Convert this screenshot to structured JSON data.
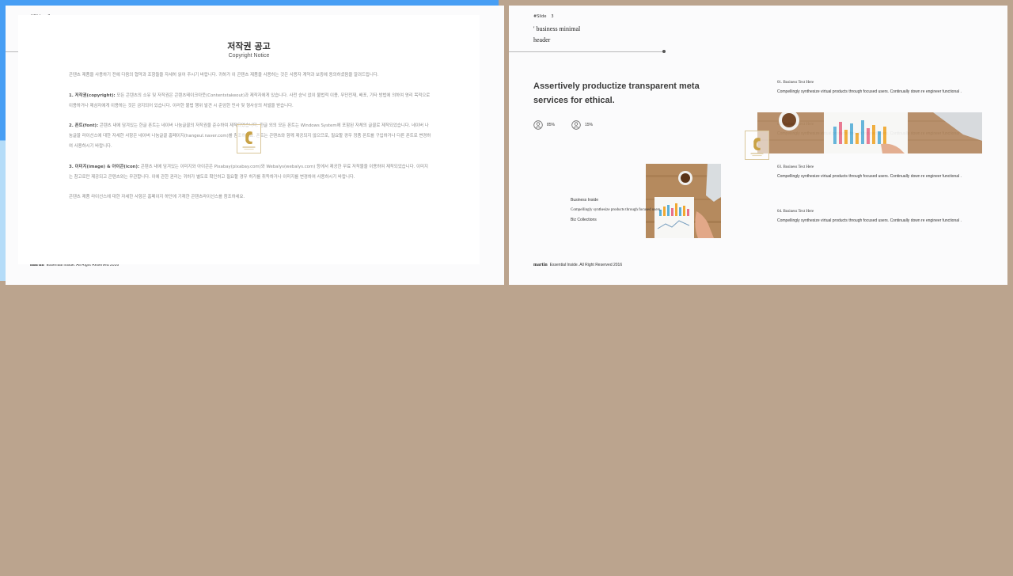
{
  "slides": [
    {
      "slide_label": "#Slide",
      "slide_number": "2",
      "header_line1": "' business minimal",
      "header_line2": "header",
      "headline": "Assertively productize transparent meta services for ethical.",
      "stats": [
        {
          "icon": "user-circle-icon",
          "value": "85%"
        },
        {
          "icon": "user-circle-icon",
          "value": "15%"
        }
      ],
      "inside": {
        "line1": "Business Inside",
        "line2": "Compellingly synthesize products through focused users.",
        "line3": "Biz Collections"
      },
      "items": [
        {
          "title": "01. Business Text Here",
          "body": "Compellingly synthesize virtual products through focused users. Continually down re engineer functional ."
        },
        {
          "title": "02. Business Text Here",
          "body": "Compellingly synthesize virtual products through focused users. Continually down re engineer functional ."
        },
        {
          "title": "03. Business Text Here",
          "body": "Compellingly synthesize virtual products through focused users. Continually down re engineer functional ."
        },
        {
          "title": "04. Business Text Here",
          "body": "Compellingly synthesize virtual products through focused users. Continually down re engineer functional ."
        }
      ],
      "footer_brand": "martin",
      "footer_text": "Essential Inside. All Right Reserved 2016"
    },
    {
      "slide_label": "#Slide",
      "slide_number": "3",
      "header_line1": "' business minimal",
      "header_line2": "header",
      "headline": "Assertively productize transparent meta services for ethical.",
      "stats": [
        {
          "icon": "user-circle-icon",
          "value": "85%"
        },
        {
          "icon": "user-circle-icon",
          "value": "15%"
        }
      ],
      "inside": {
        "line1": "Business Inside",
        "line2": "Compellingly synthesize products through focused users.",
        "line3": "Biz Collections"
      },
      "items": [
        {
          "title": "01. Business Text Here",
          "body": "Compellingly synthesize virtual products through focused users. Continually down re engineer functional ."
        },
        {
          "title": "02. Business Text Here",
          "body": "Compellingly synthesize virtual products through focused users. Continually down re engineer functional ."
        },
        {
          "title": "03. Business Text Here",
          "body": "Compellingly synthesize virtual products through focused users. Continually down re engineer functional ."
        },
        {
          "title": "04. Business Text Here",
          "body": "Compellingly synthesize virtual products through focused users. Continually down re engineer functional ."
        }
      ],
      "footer_brand": "martin",
      "footer_text": "Essential Inside. All Right Reserved 2016"
    }
  ],
  "copyright": {
    "title": "저작권 공고",
    "subtitle": "Copyright Notice",
    "intro": "콘텐츠 제품을 사용하기 전에 다음의 협약과 조항들을 자세히 읽어 주시기 바랍니다. 귀하가 이 콘텐츠 제품을 사용하는 것은 사용자 계약과 보증에 동의하셨음을 알려드립니다.",
    "sections": [
      {
        "heading": "1. 저작권(copyright):",
        "text": " 모든 콘텐츠의 소유 및 저작권은 콘텐츠테이크아웃(Contentstakeout)과 제작자에게 있습니다. 사전 승낙 없이 불법적 이용, 무단전재, 배포, 기타 방법에 의하여 영리 목적으로 이용하거나 제삼자에게 이용하는 것은 금지되어 있습니다. 이러한 불법 행위 발견 시 준엄한 민사 및 형사상의 처벌을 받습니다."
      },
      {
        "heading": "2. 폰트(font):",
        "text": " 콘텐츠 내에 담겨있는 한글 폰트는 네이버 나눔글꼴의 저작권을 준수하여 제작되었습니다. 한글 외의 모든 폰트는 Windows System에 포함된 자체의 글꼴로 제작되었습니다. 네이버 나눔글꼴 라이선스에 대한 자세한 사항은 네이버 나눔글꼴 홈페이지(hangeul.naver.com)를 참조하세요. 폰트는 콘텐츠와 함께 제공되지 않으므로, 필요할 경우 정품 폰트를 구입하거나 다른 폰트로 변경하여 사용하시기 바랍니다."
      },
      {
        "heading": "3. 이미지(image) & 아이콘(icon):",
        "text": " 콘텐츠 내에 담겨있는 이미지와 아이콘은 Pixabay(pixabay.com)와 Webalys(webalys.com) 등에서 제공한 무료 저작물을 이용하여 제작되었습니다. 이미지는 참고로만 제공되고 콘텐츠와는 무관합니다. 이에 관한 권리는 귀하가 별도로 확인하고 필요할 경우 허가를 취득하거나 이미지를 변경하여 사용하시기 바랍니다."
      }
    ],
    "outro": "콘텐츠 제품 라이선스에 대한 자세한 사항은 홈페이지 하단에 기재한 콘텐츠라이선스를 참조하세요."
  },
  "colors": {
    "background": "#bba48e",
    "copyright_blue": "#479ef4",
    "copyright_light": "#b5dcf8"
  }
}
